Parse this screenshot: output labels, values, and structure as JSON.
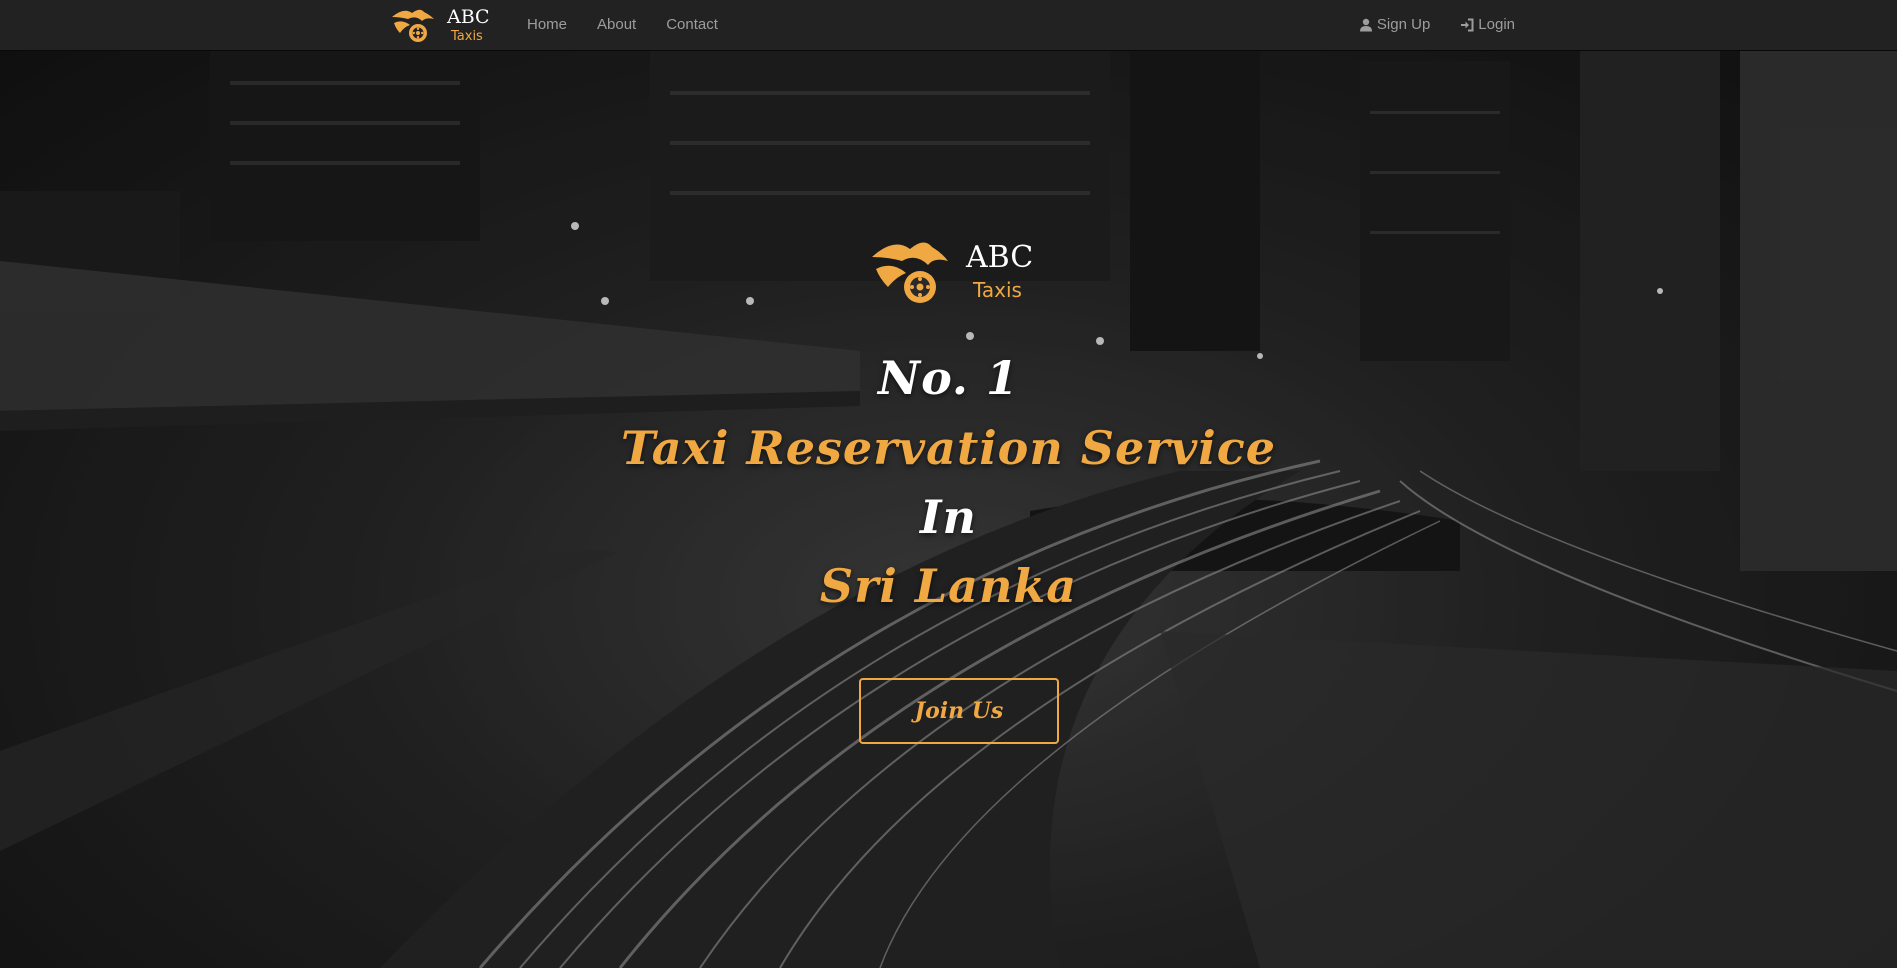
{
  "navbar": {
    "brand": {
      "name": "ABC",
      "sub": "Taxis"
    },
    "links": [
      {
        "label": "Home"
      },
      {
        "label": "About"
      },
      {
        "label": "Contact"
      }
    ],
    "right": [
      {
        "label": "Sign Up",
        "icon": "user-icon"
      },
      {
        "label": "Login",
        "icon": "login-icon"
      }
    ]
  },
  "hero": {
    "logo": {
      "name": "ABC",
      "sub": "Taxis"
    },
    "headline": [
      "No. 1",
      "Taxi Reservation Service",
      "In",
      "Sri Lanka"
    ],
    "cta_label": "Join Us"
  },
  "colors": {
    "accent": "#f0a843",
    "navbar_bg": "#222222",
    "nav_text": "#9d9d9d",
    "headline_white": "#ffffff"
  }
}
